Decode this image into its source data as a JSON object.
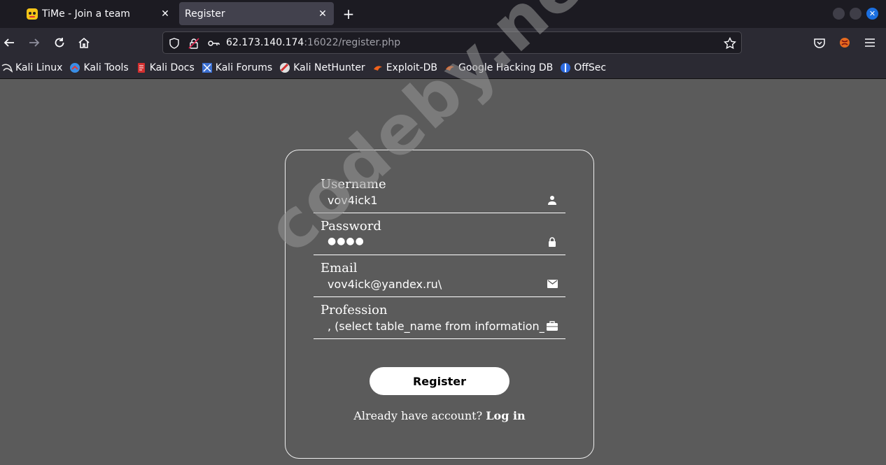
{
  "browser": {
    "tabs": [
      {
        "label": "TiMe - Join a team",
        "active": false
      },
      {
        "label": "Register",
        "active": true
      }
    ],
    "url": {
      "host": "62.173.140.174",
      "rest": ":16022/register.php"
    },
    "bookmarks": [
      {
        "label": "Kali Linux",
        "icon": "kali-dragon-icon"
      },
      {
        "label": "Kali Tools",
        "icon": "kali-tools-icon"
      },
      {
        "label": "Kali Docs",
        "icon": "kali-docs-icon"
      },
      {
        "label": "Kali Forums",
        "icon": "kali-forums-icon"
      },
      {
        "label": "Kali NetHunter",
        "icon": "nethunter-icon"
      },
      {
        "label": "Exploit-DB",
        "icon": "exploit-db-icon"
      },
      {
        "label": "Google Hacking DB",
        "icon": "ghdb-icon"
      },
      {
        "label": "OffSec",
        "icon": "offsec-icon"
      }
    ]
  },
  "form": {
    "fields": [
      {
        "label": "Username",
        "value": "vov4ick1",
        "icon": "user-icon"
      },
      {
        "label": "Password",
        "value": "●●●●",
        "icon": "lock-icon"
      },
      {
        "label": "Email",
        "value": "vov4ick@yandex.ru\\",
        "icon": "mail-icon"
      },
      {
        "label": "Profession",
        "value": ", (select table_name from information_schema",
        "icon": "briefcase-icon"
      }
    ],
    "register_label": "Register",
    "account_text": "Already have account?",
    "login_label": "Log in"
  },
  "watermark": "codeby.net",
  "colors": {
    "page_bg": "#5b5b5b",
    "tab_bar": "#1c1b22",
    "toolbar": "#2b2a33",
    "accent": "#1b6fe0"
  }
}
